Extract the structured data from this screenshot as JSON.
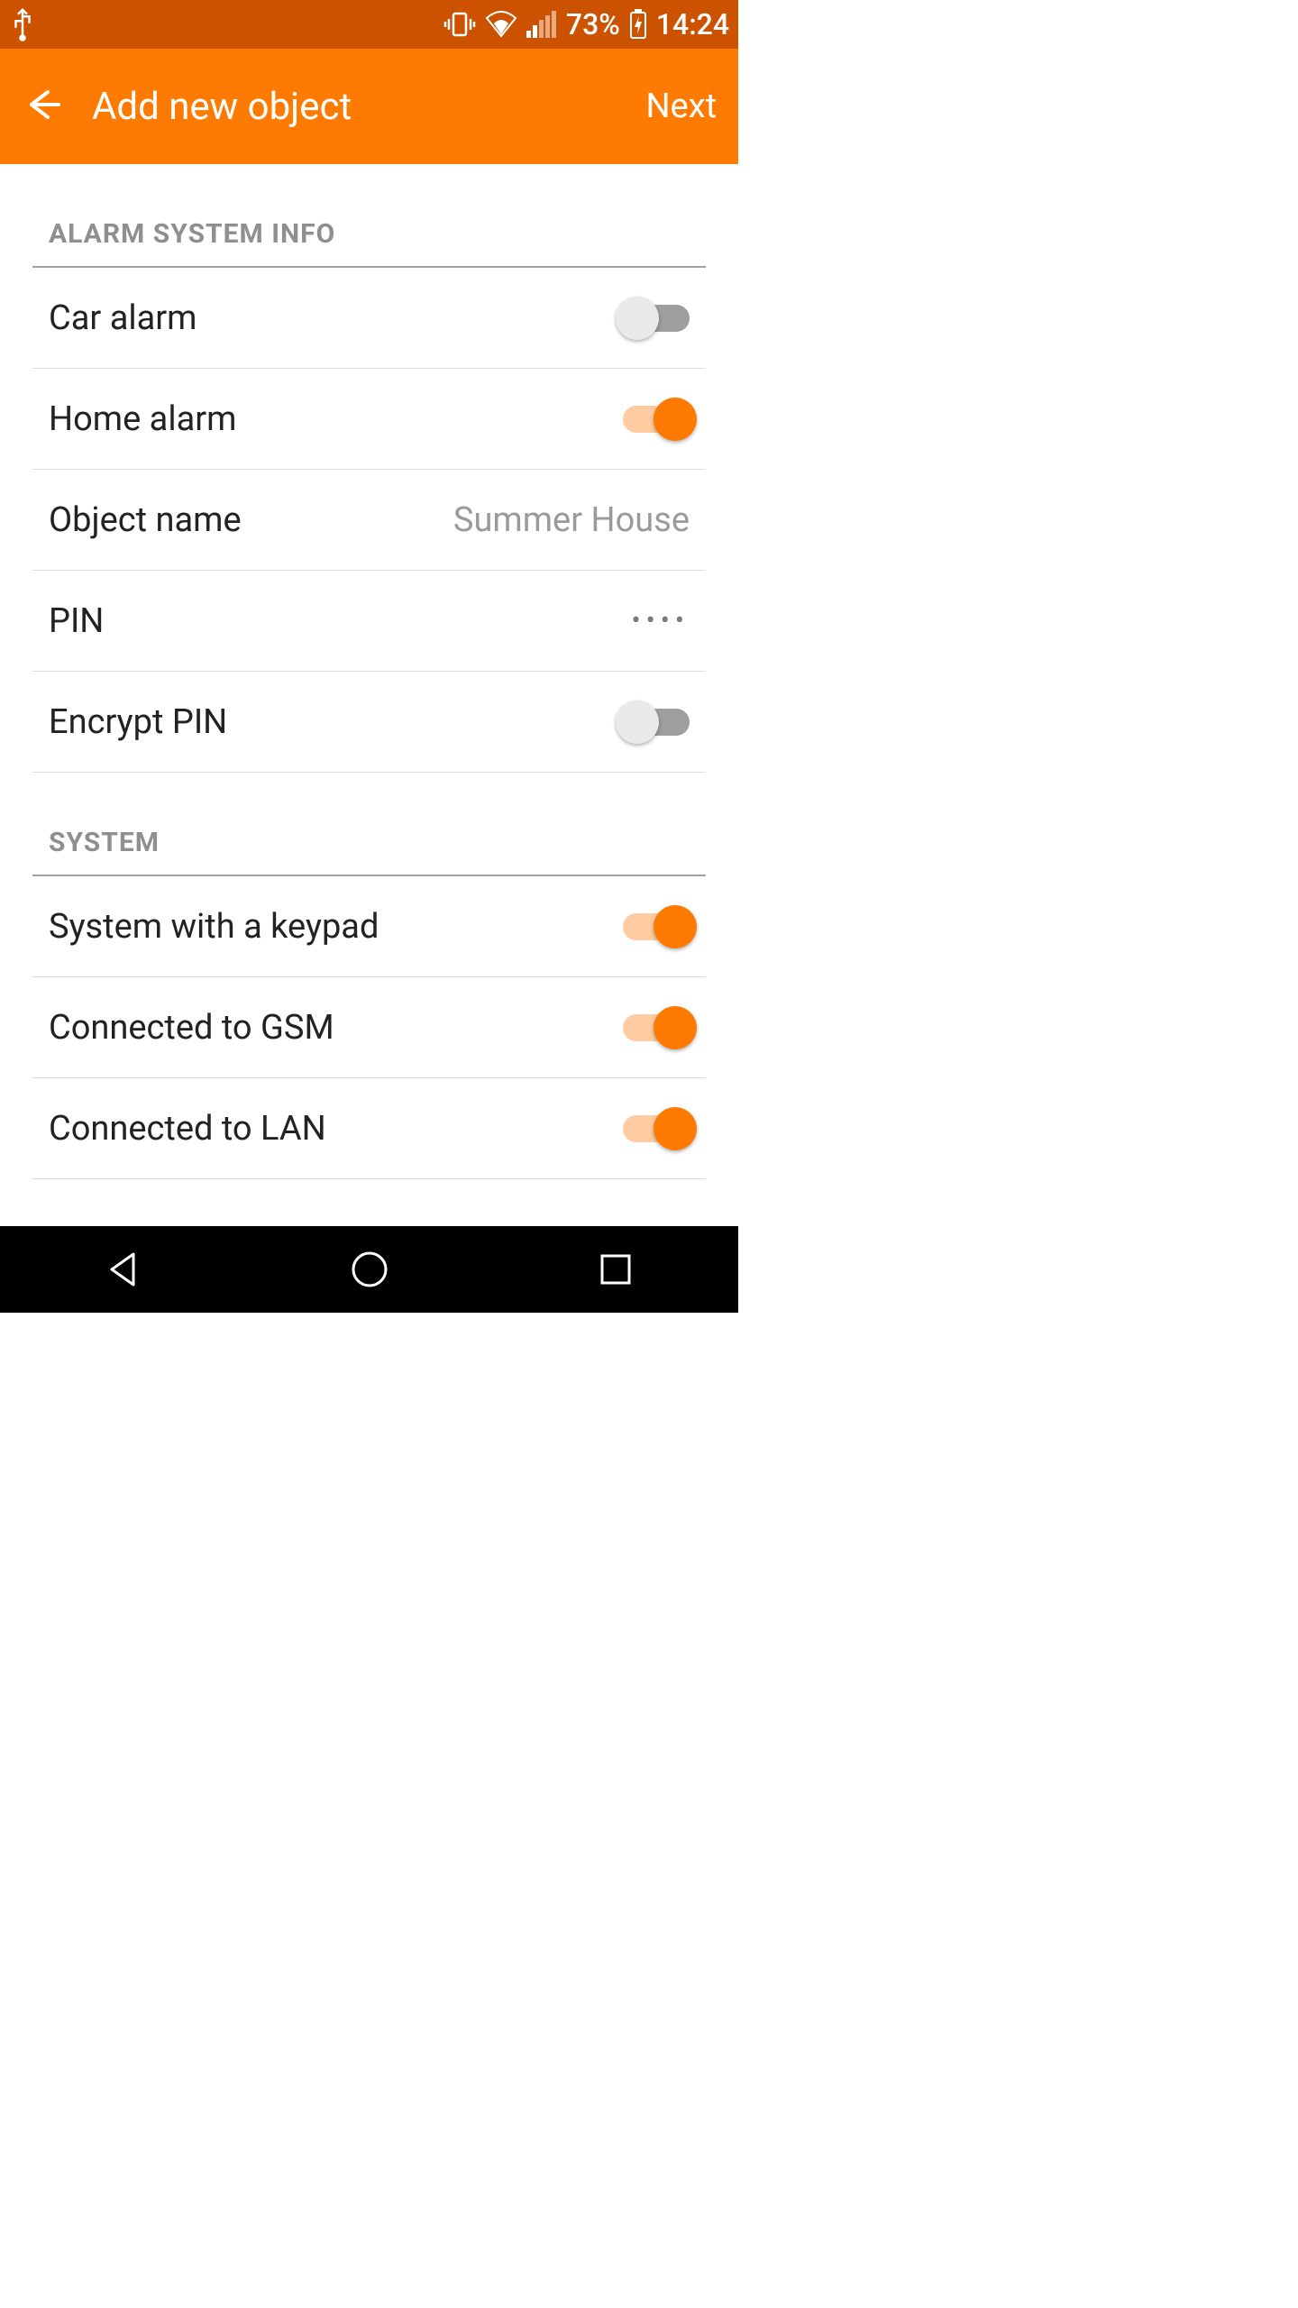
{
  "statusbar": {
    "battery_pct": "73%",
    "time": "14:24"
  },
  "appbar": {
    "title": "Add new object",
    "next": "Next"
  },
  "sections": {
    "alarm": {
      "header": "ALARM SYSTEM INFO",
      "car_alarm": {
        "label": "Car alarm",
        "on": false
      },
      "home_alarm": {
        "label": "Home alarm",
        "on": true
      },
      "object_name": {
        "label": "Object name",
        "value": "Summer House"
      },
      "pin": {
        "label": "PIN",
        "value": "••••"
      },
      "encrypt_pin": {
        "label": "Encrypt PIN",
        "on": false
      }
    },
    "system": {
      "header": "SYSTEM",
      "keypad": {
        "label": "System with a keypad",
        "on": true
      },
      "gsm": {
        "label": "Connected to GSM",
        "on": true
      },
      "lan": {
        "label": "Connected to LAN",
        "on": true
      }
    }
  }
}
